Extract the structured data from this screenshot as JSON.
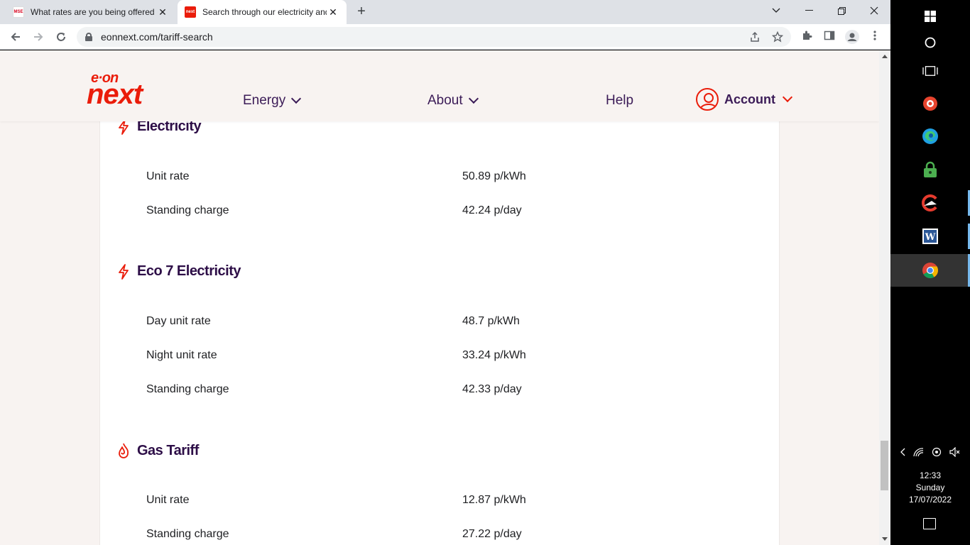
{
  "browser": {
    "tabs": [
      {
        "title": "What rates are you being offered",
        "favicon_text": "MSE",
        "active": false
      },
      {
        "title": "Search through our electricity and",
        "favicon_text": "next",
        "active": true
      }
    ],
    "url": "eonnext.com/tariff-search"
  },
  "site": {
    "logo_top": "e·on",
    "logo_bottom": "next",
    "nav": {
      "energy": "Energy",
      "about": "About",
      "help": "Help",
      "account": "Account"
    }
  },
  "tariffs": {
    "electricity": {
      "title": "Electricity",
      "rows": [
        {
          "label": "Unit rate",
          "value": "50.89 p/kWh"
        },
        {
          "label": "Standing charge",
          "value": "42.24 p/day"
        }
      ]
    },
    "eco7": {
      "title": "Eco 7 Electricity",
      "rows": [
        {
          "label": "Day unit rate",
          "value": "48.7 p/kWh"
        },
        {
          "label": "Night unit rate",
          "value": "33.24 p/kWh"
        },
        {
          "label": "Standing charge",
          "value": "42.33 p/day"
        }
      ]
    },
    "gas": {
      "title": "Gas Tariff",
      "rows": [
        {
          "label": "Unit rate",
          "value": "12.87 p/kWh"
        },
        {
          "label": "Standing charge",
          "value": "27.22 p/day"
        }
      ]
    }
  },
  "taskbar": {
    "time": "12:33",
    "day": "Sunday",
    "date": "17/07/2022"
  },
  "colors": {
    "brand_red": "#ea1c0a",
    "brand_purple": "#3b1b57",
    "page_bg": "#f8f3f1"
  }
}
